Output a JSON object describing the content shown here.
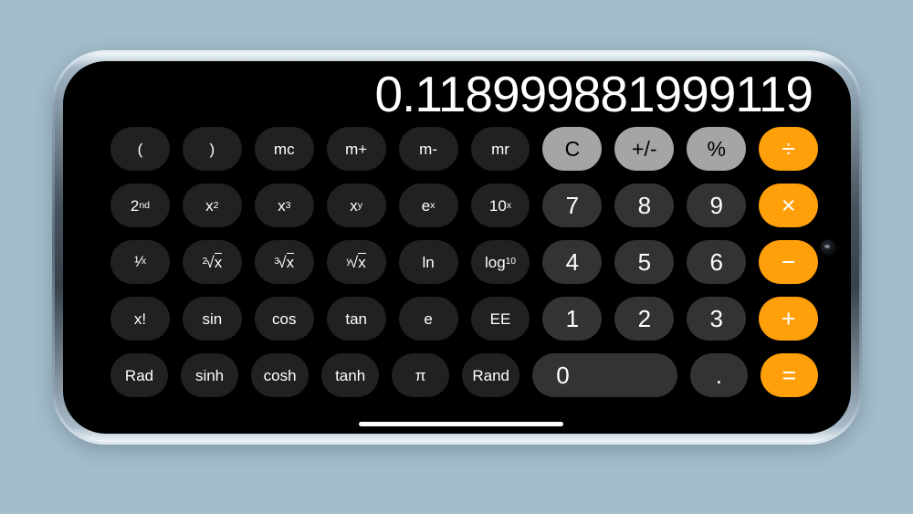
{
  "app": {
    "name": "Calculator",
    "mode": "scientific-landscape"
  },
  "colors": {
    "background": "#a4bdcb",
    "screen": "#000000",
    "function_key": "#212121",
    "digit_key": "#333333",
    "utility_key": "#a5a5a5",
    "operator_key": "#ff9f0a",
    "display_text": "#ffffff",
    "phone_frame": "#8fa4b4"
  },
  "display": {
    "value": "0.118999881999119"
  },
  "keypad": {
    "rows": [
      [
        {
          "label": "(",
          "name": "key-open-paren",
          "type": "fn"
        },
        {
          "label": ")",
          "name": "key-close-paren",
          "type": "fn"
        },
        {
          "label": "mc",
          "name": "key-memory-clear",
          "type": "fn"
        },
        {
          "label": "m+",
          "name": "key-memory-add",
          "type": "fn"
        },
        {
          "label": "m-",
          "name": "key-memory-subtract",
          "type": "fn"
        },
        {
          "label": "mr",
          "name": "key-memory-recall",
          "type": "fn"
        },
        {
          "label": "C",
          "name": "key-clear",
          "type": "util"
        },
        {
          "label": "+/-",
          "name": "key-sign-toggle",
          "type": "util"
        },
        {
          "label": "%",
          "name": "key-percent",
          "type": "util"
        },
        {
          "label": "÷",
          "name": "key-divide",
          "type": "op"
        }
      ],
      [
        {
          "label": "2nd",
          "name": "key-second-function",
          "type": "fn",
          "html": "2<span class=\"sup\">nd</span>"
        },
        {
          "label": "x2",
          "name": "key-x-squared",
          "type": "fn",
          "html": "x<span class=\"sup\">2</span>"
        },
        {
          "label": "x3",
          "name": "key-x-cubed",
          "type": "fn",
          "html": "x<span class=\"sup\">3</span>"
        },
        {
          "label": "xy",
          "name": "key-x-power-y",
          "type": "fn",
          "html": "x<span class=\"sup\">y</span>"
        },
        {
          "label": "ex",
          "name": "key-e-power-x",
          "type": "fn",
          "html": "e<span class=\"sup\">x</span>"
        },
        {
          "label": "10x",
          "name": "key-ten-power-x",
          "type": "fn",
          "html": "10<span class=\"sup\">x</span>"
        },
        {
          "label": "7",
          "name": "key-7",
          "type": "digit"
        },
        {
          "label": "8",
          "name": "key-8",
          "type": "digit"
        },
        {
          "label": "9",
          "name": "key-9",
          "type": "digit"
        },
        {
          "label": "×",
          "name": "key-multiply",
          "type": "op"
        }
      ],
      [
        {
          "label": "1/x",
          "name": "key-reciprocal",
          "type": "fn",
          "html": "<span class=\"frac\">¹⁄</span><span class=\"sub\">x</span>"
        },
        {
          "label": "2√x",
          "name": "key-square-root",
          "type": "fn",
          "html": "<span class=\"radical\"><span class=\"idx\">2</span>√<span style=\"border-top:1px solid #fff;padding-top:1px\">x</span></span>"
        },
        {
          "label": "3√x",
          "name": "key-cube-root",
          "type": "fn",
          "html": "<span class=\"radical\"><span class=\"idx\">3</span>√<span style=\"border-top:1px solid #fff;padding-top:1px\">x</span></span>"
        },
        {
          "label": "y√x",
          "name": "key-nth-root",
          "type": "fn",
          "html": "<span class=\"radical\"><span class=\"idx\">y</span>√<span style=\"border-top:1px solid #fff;padding-top:1px\">x</span></span>"
        },
        {
          "label": "ln",
          "name": "key-natural-log",
          "type": "fn"
        },
        {
          "label": "log10",
          "name": "key-log-base-10",
          "type": "fn",
          "html": "log<span class=\"sub\">10</span>"
        },
        {
          "label": "4",
          "name": "key-4",
          "type": "digit"
        },
        {
          "label": "5",
          "name": "key-5",
          "type": "digit"
        },
        {
          "label": "6",
          "name": "key-6",
          "type": "digit"
        },
        {
          "label": "−",
          "name": "key-subtract",
          "type": "op"
        }
      ],
      [
        {
          "label": "x!",
          "name": "key-factorial",
          "type": "fn"
        },
        {
          "label": "sin",
          "name": "key-sine",
          "type": "fn"
        },
        {
          "label": "cos",
          "name": "key-cosine",
          "type": "fn"
        },
        {
          "label": "tan",
          "name": "key-tangent",
          "type": "fn"
        },
        {
          "label": "e",
          "name": "key-euler-number",
          "type": "fn"
        },
        {
          "label": "EE",
          "name": "key-exponent-entry",
          "type": "fn"
        },
        {
          "label": "1",
          "name": "key-1",
          "type": "digit"
        },
        {
          "label": "2",
          "name": "key-2",
          "type": "digit"
        },
        {
          "label": "3",
          "name": "key-3",
          "type": "digit"
        },
        {
          "label": "+",
          "name": "key-add",
          "type": "op"
        }
      ],
      [
        {
          "label": "Rad",
          "name": "key-radians-toggle",
          "type": "fn"
        },
        {
          "label": "sinh",
          "name": "key-hyperbolic-sine",
          "type": "fn"
        },
        {
          "label": "cosh",
          "name": "key-hyperbolic-cosine",
          "type": "fn"
        },
        {
          "label": "tanh",
          "name": "key-hyperbolic-tangent",
          "type": "fn"
        },
        {
          "label": "π",
          "name": "key-pi",
          "type": "fn"
        },
        {
          "label": "Rand",
          "name": "key-random",
          "type": "fn"
        },
        {
          "label": "0",
          "name": "key-0",
          "type": "digit zero"
        },
        {
          "label": ".",
          "name": "key-decimal-point",
          "type": "digit"
        },
        {
          "label": "=",
          "name": "key-equals",
          "type": "op"
        }
      ]
    ]
  },
  "system": {
    "home_indicator": "home-indicator",
    "front_camera": "front-camera"
  }
}
